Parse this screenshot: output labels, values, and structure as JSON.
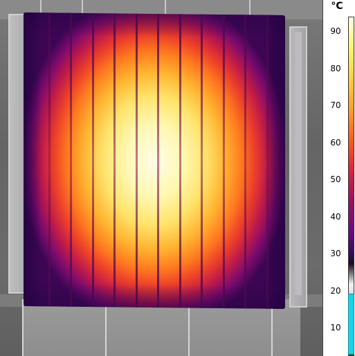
{
  "colorbar": {
    "unit": "°C",
    "ticks": [
      "90",
      "80",
      "70",
      "60",
      "50",
      "40",
      "30",
      "20",
      "10"
    ],
    "marker_color": "#18d4e6"
  },
  "scene": {
    "coil_strip_count": 12,
    "palette": "iron"
  }
}
